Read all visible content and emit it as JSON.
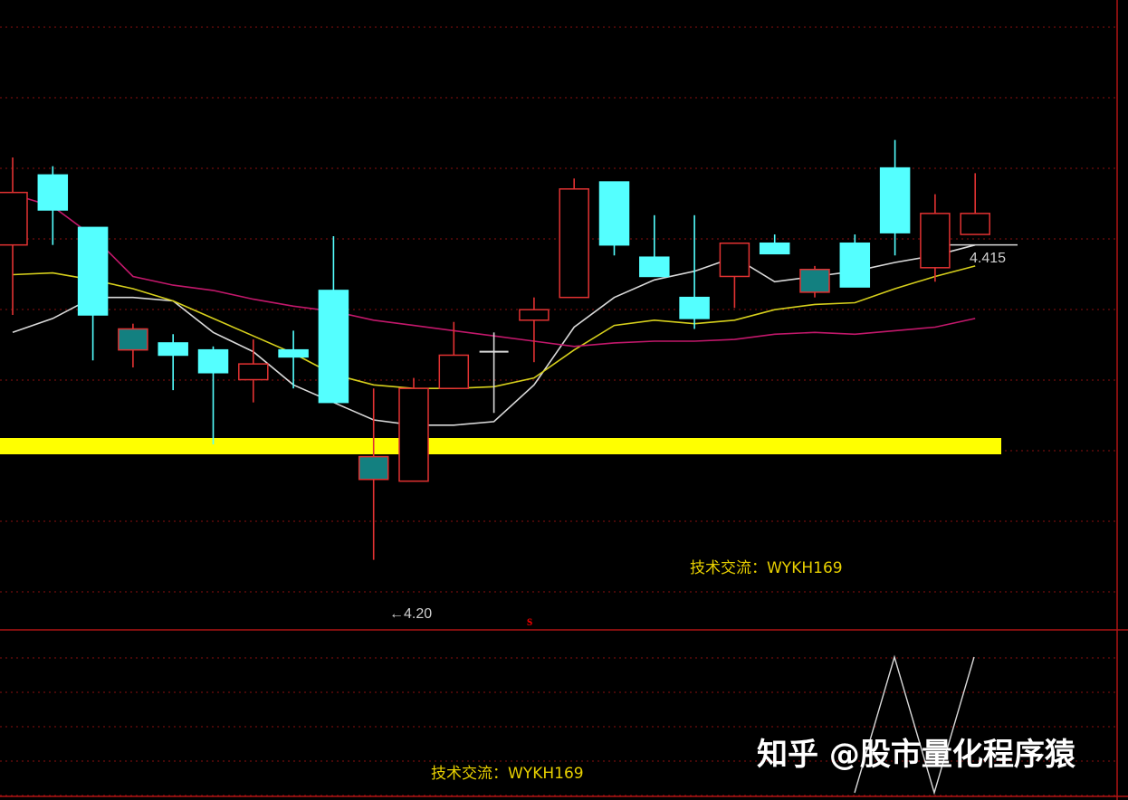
{
  "chart_data": {
    "type": "candlestick",
    "y_axis": {
      "min": 4.16,
      "max": 4.52,
      "scale": "linear",
      "labels_visible": false
    },
    "grid": "horizontal dotted red",
    "candles": [
      {
        "o": 4.41,
        "c": 4.38,
        "h": 4.43,
        "l": 4.34,
        "color": "red"
      },
      {
        "o": 4.4,
        "c": 4.42,
        "h": 4.425,
        "l": 4.38,
        "color": "cyan"
      },
      {
        "o": 4.39,
        "c": 4.34,
        "h": 4.39,
        "l": 4.314,
        "color": "cyan"
      },
      {
        "o": 4.32,
        "c": 4.332,
        "h": 4.335,
        "l": 4.31,
        "color": "teal"
      },
      {
        "o": 4.324,
        "c": 4.317,
        "h": 4.329,
        "l": 4.297,
        "color": "cyan"
      },
      {
        "o": 4.32,
        "c": 4.307,
        "h": 4.322,
        "l": 4.266,
        "color": "cyan"
      },
      {
        "o": 4.303,
        "c": 4.312,
        "h": 4.326,
        "l": 4.29,
        "color": "red"
      },
      {
        "o": 4.32,
        "c": 4.316,
        "h": 4.331,
        "l": 4.298,
        "color": "cyan"
      },
      {
        "o": 4.354,
        "c": 4.29,
        "h": 4.385,
        "l": 4.29,
        "color": "cyan"
      },
      {
        "o": 4.246,
        "c": 4.259,
        "h": 4.298,
        "l": 4.2,
        "color": "teal"
      },
      {
        "o": 4.245,
        "c": 4.298,
        "h": 4.304,
        "l": 4.245,
        "color": "red"
      },
      {
        "o": 4.317,
        "c": 4.298,
        "h": 4.336,
        "l": 4.298,
        "color": "red"
      },
      {
        "o": 4.319,
        "c": 4.319,
        "h": 4.33,
        "l": 4.284,
        "color": "white"
      },
      {
        "o": 4.337,
        "c": 4.343,
        "h": 4.35,
        "l": 4.313,
        "color": "red"
      },
      {
        "o": 4.35,
        "c": 4.412,
        "h": 4.418,
        "l": 4.35,
        "color": "red"
      },
      {
        "o": 4.416,
        "c": 4.38,
        "h": 4.416,
        "l": 4.374,
        "color": "cyan"
      },
      {
        "o": 4.373,
        "c": 4.362,
        "h": 4.397,
        "l": 4.362,
        "color": "cyan"
      },
      {
        "o": 4.35,
        "c": 4.338,
        "h": 4.397,
        "l": 4.332,
        "color": "cyan"
      },
      {
        "o": 4.362,
        "c": 4.381,
        "h": 4.381,
        "l": 4.344,
        "color": "red"
      },
      {
        "o": 4.381,
        "c": 4.375,
        "h": 4.386,
        "l": 4.375,
        "color": "cyan"
      },
      {
        "o": 4.353,
        "c": 4.366,
        "h": 4.368,
        "l": 4.35,
        "color": "teal"
      },
      {
        "o": 4.381,
        "c": 4.356,
        "h": 4.386,
        "l": 4.356,
        "color": "cyan"
      },
      {
        "o": 4.424,
        "c": 4.387,
        "h": 4.44,
        "l": 4.374,
        "color": "cyan"
      },
      {
        "o": 4.367,
        "c": 4.398,
        "h": 4.409,
        "l": 4.359,
        "color": "red"
      },
      {
        "o": 4.386,
        "c": 4.398,
        "h": 4.421,
        "l": 4.386,
        "color": "red"
      }
    ],
    "ma_lines": [
      {
        "color": "#d9d9d9",
        "values": [
          4.33,
          4.338,
          4.35,
          4.35,
          4.348,
          4.33,
          4.319,
          4.3,
          4.29,
          4.28,
          4.277,
          4.277,
          4.279,
          4.3,
          4.333,
          4.35,
          4.36,
          4.365,
          4.373,
          4.359,
          4.362,
          4.365,
          4.37,
          4.374,
          4.38
        ]
      },
      {
        "color": "#d6cf1c",
        "values": [
          4.363,
          4.364,
          4.36,
          4.355,
          4.348,
          4.338,
          4.328,
          4.318,
          4.306,
          4.3,
          4.298,
          4.298,
          4.299,
          4.304,
          4.32,
          4.334,
          4.337,
          4.335,
          4.337,
          4.343,
          4.346,
          4.347,
          4.355,
          4.362,
          4.368
        ]
      },
      {
        "color": "#c2186b",
        "values": [
          4.409,
          4.402,
          4.385,
          4.362,
          4.357,
          4.354,
          4.349,
          4.345,
          4.342,
          4.337,
          4.334,
          4.331,
          4.328,
          4.325,
          4.322,
          4.324,
          4.325,
          4.325,
          4.326,
          4.329,
          4.33,
          4.329,
          4.331,
          4.333,
          4.338
        ]
      }
    ],
    "support_line": {
      "value": 4.265,
      "color": "#ffff00"
    },
    "annotations": {
      "low_label": "4.20",
      "ma_label": "4.415",
      "note": "技术交流：WYKH169",
      "signal": "s"
    },
    "sub_indicator": {
      "color": "#d9d9d9",
      "values": [
        0,
        1,
        0,
        1
      ]
    }
  },
  "footer": {
    "note": "技术交流：WYKH169",
    "watermark": "知乎 @股市量化程序猿"
  }
}
